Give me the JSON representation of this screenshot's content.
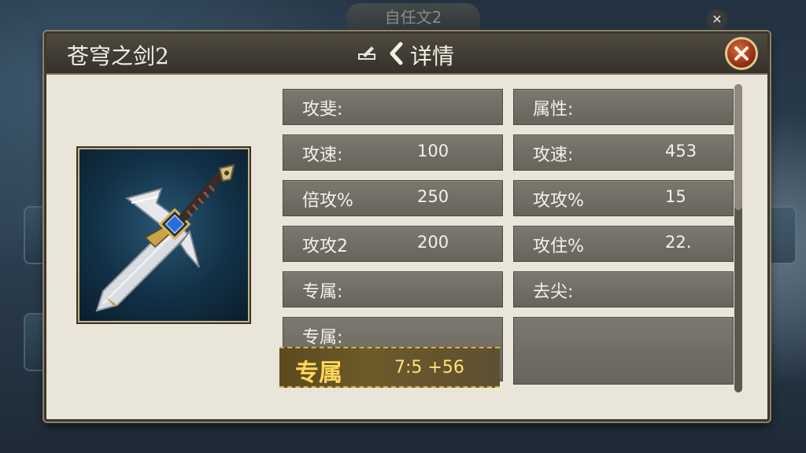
{
  "background": {
    "tab_label": "自任文2",
    "close_glyph": "✕"
  },
  "panel": {
    "title": "苍穹之剑2",
    "detail_label": "详情",
    "close_button": "close"
  },
  "left_column": [
    {
      "label": "攻斐:",
      "value": ""
    },
    {
      "label": "攻速:",
      "value": "100"
    },
    {
      "label": "倍攻%",
      "value": "250"
    },
    {
      "label": "攻攻2",
      "value": "200"
    },
    {
      "label": "专属:",
      "value": ""
    },
    {
      "label": "专属:",
      "value": ""
    }
  ],
  "exclusive": {
    "label": "专属",
    "value": "7:5  +56"
  },
  "right_column": [
    {
      "label": "属性:",
      "value": ""
    },
    {
      "label": "攻速:",
      "value": "453"
    },
    {
      "label": "攻攻%",
      "value": "15"
    },
    {
      "label": "攻住%",
      "value": "22."
    },
    {
      "label": "去尖:",
      "value": ""
    },
    {
      "label": "",
      "value": ""
    }
  ],
  "colors": {
    "panel_bg": "#e9e5d9",
    "titlebar": "#35302a",
    "cell_bg": "#6f6c64",
    "exclusive_text": "#ffd75a"
  }
}
